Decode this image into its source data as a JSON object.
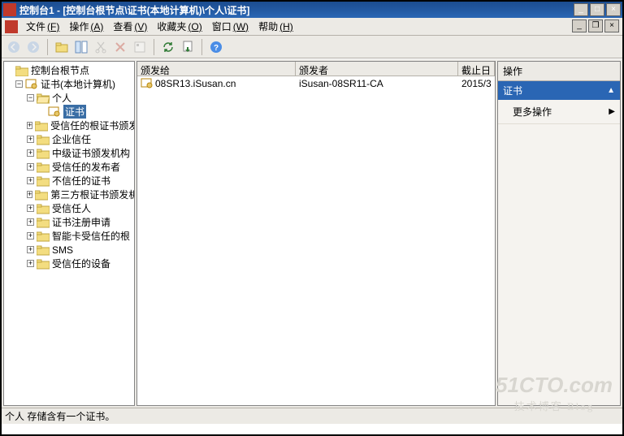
{
  "window": {
    "title": "控制台1 - [控制台根节点\\证书(本地计算机)\\个人\\证书]"
  },
  "menu": {
    "file": {
      "label": "文件",
      "hotkey": "(F)"
    },
    "action": {
      "label": "操作",
      "hotkey": "(A)"
    },
    "view": {
      "label": "查看",
      "hotkey": "(V)"
    },
    "favorites": {
      "label": "收藏夹",
      "hotkey": "(O)"
    },
    "window_menu": {
      "label": "窗口",
      "hotkey": "(W)"
    },
    "help": {
      "label": "帮助",
      "hotkey": "(H)"
    }
  },
  "tree": {
    "root_label": "控制台根节点",
    "cert_label": "证书(本地计算机)",
    "personal_label": "个人",
    "selected_label": "证书",
    "nodes": {
      "n0": "受信任的根证书颁发机构",
      "n1": "企业信任",
      "n2": "中级证书颁发机构",
      "n3": "受信任的发布者",
      "n4": "不信任的证书",
      "n5": "第三方根证书颁发机构",
      "n6": "受信任人",
      "n7": "证书注册申请",
      "n8": "智能卡受信任的根",
      "n9": "SMS",
      "n10": "受信任的设备"
    }
  },
  "columns": {
    "issued_to": "颁发给",
    "issuer": "颁发者",
    "expiry": "截止日"
  },
  "rows": [
    {
      "issued_to": "08SR13.iSusan.cn",
      "issuer": "iSusan-08SR11-CA",
      "expiry": "2015/3"
    }
  ],
  "actions": {
    "header": "操作",
    "category": "证书",
    "more": "更多操作"
  },
  "status": "个人 存储含有一个证书。",
  "watermark": {
    "l1": "51CTO.com",
    "l2": "技术博客  Blog"
  }
}
